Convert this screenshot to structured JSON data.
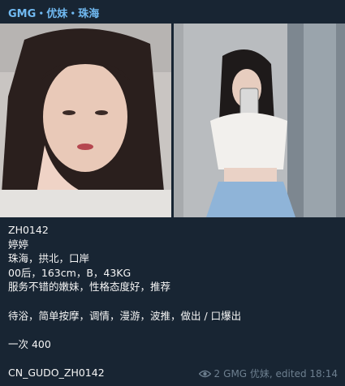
{
  "message": {
    "sender": "GMG・优妹・珠海",
    "photos": [
      {
        "name": "photo-1",
        "alt": "photo"
      },
      {
        "name": "photo-2",
        "alt": "photo"
      }
    ],
    "lines": [
      "ZH0142",
      "婷婷",
      "珠海，拱北，口岸",
      "00后，163cm，B，43KG",
      "服务不错的嫩妹，性格态度好，推荐",
      "",
      "待浴，简单按摩，调情，漫游，波推，做出 / 口爆出",
      "",
      "一次 400",
      "",
      "CN_GUDO_ZH0142"
    ],
    "views": "2",
    "footer": "GMG 优妹, edited 18:14"
  },
  "colors": {
    "background": "#17212b",
    "bubble": "#182533",
    "sender": "#71baf2",
    "text": "#f5f5f5",
    "meta": "#6d7f8f"
  }
}
